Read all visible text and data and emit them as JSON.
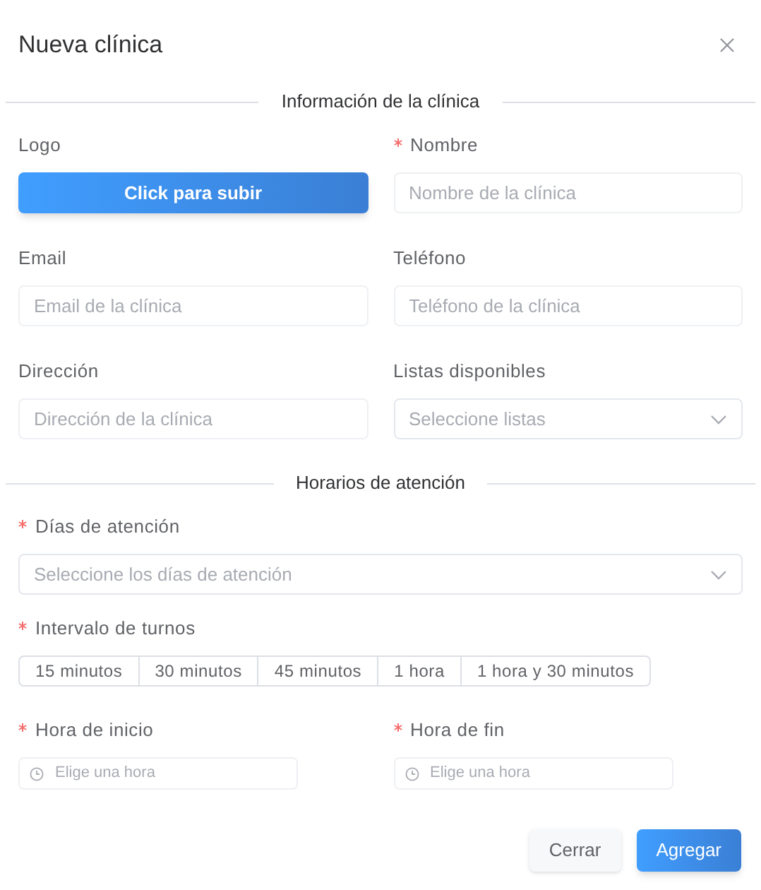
{
  "dialog": {
    "title": "Nueva clínica"
  },
  "sections": [
    {
      "title": "Información de la clínica",
      "fields": [
        {
          "kind": "upload",
          "label": "Logo",
          "required": false,
          "button": "Click para subir"
        },
        {
          "kind": "input",
          "label": "Nombre",
          "required": true,
          "placeholder": "Nombre de la clínica"
        },
        {
          "kind": "input",
          "label": "Email",
          "required": false,
          "placeholder": "Email de la clínica"
        },
        {
          "kind": "input",
          "label": "Teléfono",
          "required": false,
          "placeholder": "Teléfono de la clínica"
        },
        {
          "kind": "input",
          "label": "Dirección",
          "required": false,
          "placeholder": "Dirección de la clínica"
        },
        {
          "kind": "select",
          "label": "Listas disponibles",
          "required": false,
          "placeholder": "Seleccione listas"
        }
      ]
    },
    {
      "title": "Horarios de atención",
      "fields": [
        {
          "kind": "select",
          "label": "Días de atención",
          "required": true,
          "placeholder": "Seleccione los días de atención",
          "wide": true
        },
        {
          "kind": "segments",
          "label": "Intervalo de turnos",
          "required": true,
          "wide": true,
          "options": [
            {
              "label": "15 minutos",
              "selected": false
            },
            {
              "label": "30 minutos",
              "selected": false
            },
            {
              "label": "45 minutos",
              "selected": false
            },
            {
              "label": "1 hora",
              "selected": false
            },
            {
              "label": "1 hora y 30 minutos",
              "selected": false
            }
          ]
        },
        {
          "kind": "time",
          "label": "Hora de inicio",
          "required": true,
          "placeholder": "Elige una hora"
        },
        {
          "kind": "time",
          "label": "Hora de fin",
          "required": true,
          "placeholder": "Elige una hora"
        }
      ]
    }
  ],
  "buttons": [
    {
      "label": "Cerrar",
      "primary": false
    },
    {
      "label": "Agregar",
      "primary": true
    }
  ]
}
